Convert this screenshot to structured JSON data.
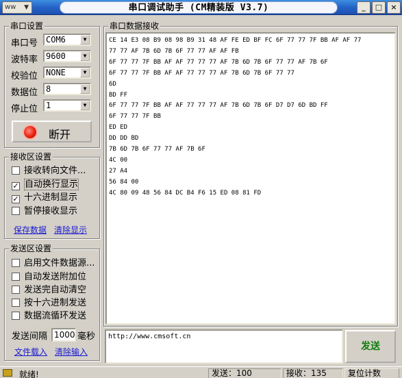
{
  "window": {
    "sys_menu_label": "ww",
    "title": "串口调试助手 (CM精装版 V3.7)",
    "minimize": "_",
    "maximize": "□",
    "close": "×"
  },
  "serial_settings": {
    "group_title": "串口设置",
    "port_label": "串口号",
    "port_value": "COM6",
    "baud_label": "波特率",
    "baud_value": "9600",
    "parity_label": "校验位",
    "parity_value": "NONE",
    "databits_label": "数据位",
    "databits_value": "8",
    "stopbits_label": "停止位",
    "stopbits_value": "1",
    "disconnect_button": "断开"
  },
  "receive_settings": {
    "group_title": "接收区设置",
    "options": [
      {
        "label": "接收转向文件...",
        "checked": false
      },
      {
        "label": "自动换行显示",
        "checked": true
      },
      {
        "label": "十六进制显示",
        "checked": true
      },
      {
        "label": "暂停接收显示",
        "checked": false
      }
    ],
    "save_data_link": "保存数据",
    "clear_display_link": "清除显示"
  },
  "send_settings": {
    "group_title": "发送区设置",
    "options": [
      {
        "label": "启用文件数据源...",
        "checked": false
      },
      {
        "label": "自动发送附加位",
        "checked": false
      },
      {
        "label": "发送完自动清空",
        "checked": false
      },
      {
        "label": "按十六进制发送",
        "checked": false
      },
      {
        "label": "数据流循环发送",
        "checked": false
      }
    ],
    "interval_label": "发送间隔",
    "interval_value": "1000",
    "interval_unit": "毫秒",
    "load_file_link": "文件载入",
    "clear_input_link": "清除输入"
  },
  "receive_area": {
    "group_title": "串口数据接收",
    "lines": [
      "CE 14 E3 08 B9 08 98 B9 31 48 AF FE ED BF FC 6F 77 77 7F BB AF AF 77",
      "77 77 AF 7B 6D 7B 6F 77 77 AF AF FB",
      "6F 77 77 7F BB AF AF 77 77 77 AF 7B 6D 7B 6F 77 77 AF 7B 6F",
      "6F 77 77 7F BB AF AF 77 77 77 AF 7B 6D 7B 6F 77 77",
      "6D",
      "BD FF",
      "6F 77 77 7F BB AF AF 77 77 77 AF 7B 6D 7B 6F D7 D7 6D BD FF",
      "6F 77 77 7F BB",
      "ED ED",
      "DD DD BD",
      "7B 6D 7B 6F 77 77 AF 7B 6F",
      "4C 00",
      "27 A4",
      "56 84 00",
      "4C 80 09 48 56 84 DC B4 F6 15 ED 08 81 FD"
    ]
  },
  "send_area": {
    "text": "http://www.cmsoft.cn",
    "send_button": "发送"
  },
  "status_bar": {
    "ready": "就绪!",
    "sent": "发送：100",
    "received": "接收：135",
    "reset_count": "复位计数"
  }
}
